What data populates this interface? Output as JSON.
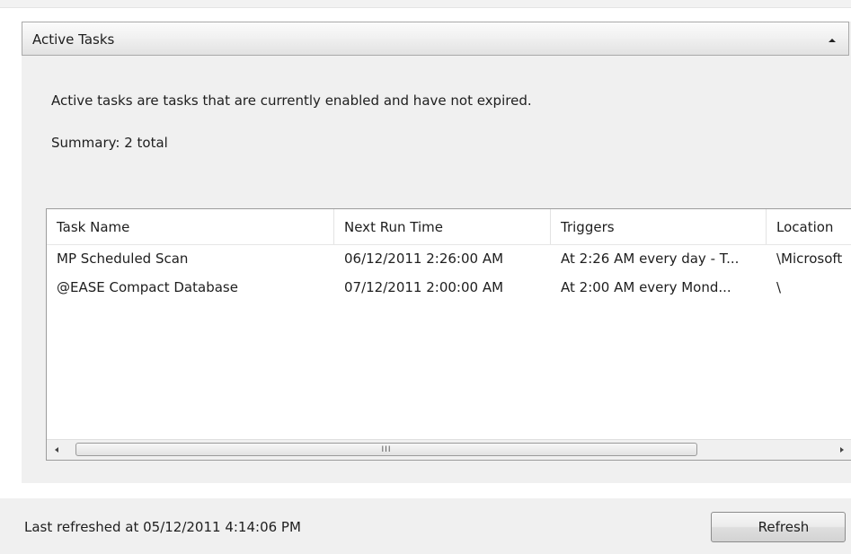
{
  "section": {
    "title": "Active Tasks",
    "collapse_icon": "chevron-up-icon",
    "description": "Active tasks are tasks that are currently enabled and have not expired.",
    "summary": "Summary: 2 total"
  },
  "table": {
    "columns": [
      "Task Name",
      "Next Run Time",
      "Triggers",
      "Location"
    ],
    "rows": [
      [
        "MP Scheduled Scan",
        "06/12/2011 2:26:00 AM",
        "At 2:26 AM every day - T...",
        "\\Microsoft"
      ],
      [
        "@EASE Compact Database",
        "07/12/2011 2:00:00 AM",
        "At 2:00 AM every Mond...",
        "\\"
      ]
    ],
    "scrollbar": {
      "left_icon": "arrow-left-icon",
      "right_icon": "arrow-right-icon",
      "grip": "III"
    }
  },
  "footer": {
    "last_refreshed": "Last refreshed at 05/12/2011 4:14:06 PM",
    "refresh_label": "Refresh"
  }
}
